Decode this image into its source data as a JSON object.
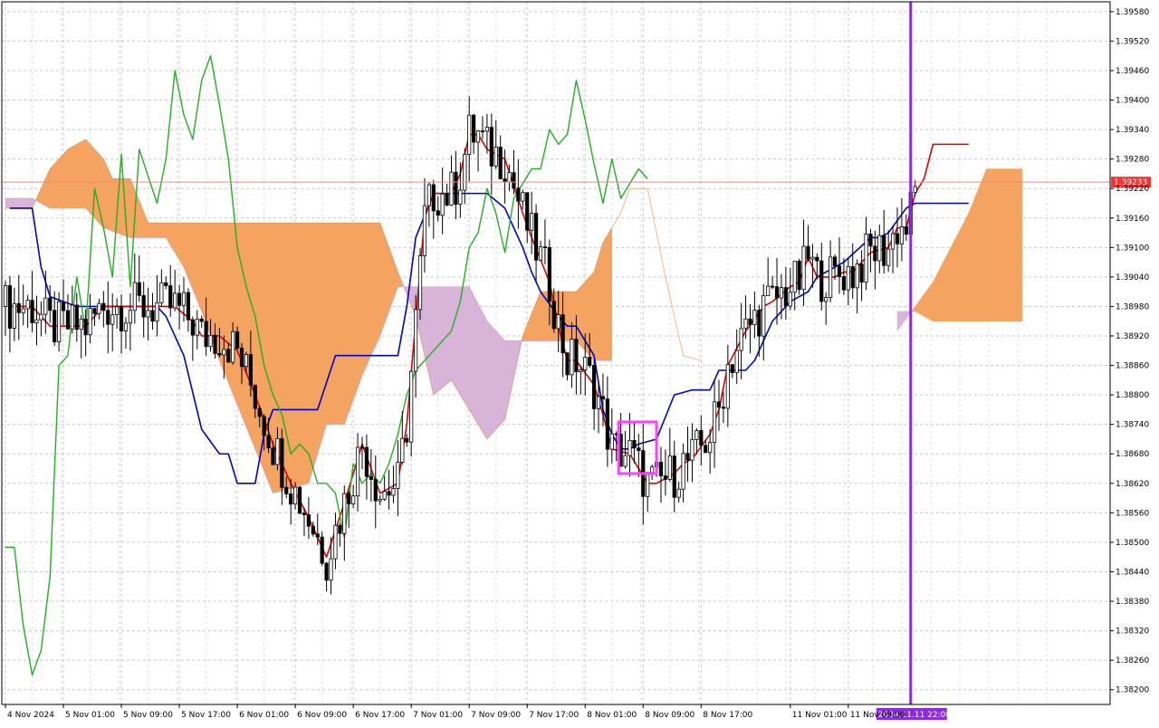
{
  "chart_data": {
    "type": "candlestick",
    "indicator": "Ichimoku Kinko Hyo",
    "current_price_label": "1.39233",
    "current_price": 1.39233,
    "cursor_time_label": "2024.11.11 22:00",
    "y_ticks": [
      "1.39580",
      "1.39520",
      "1.39460",
      "1.39400",
      "1.39340",
      "1.39280",
      "1.39220",
      "1.39160",
      "1.39100",
      "1.39040",
      "1.38980",
      "1.38920",
      "1.38860",
      "1.38800",
      "1.38740",
      "1.38680",
      "1.38620",
      "1.38560",
      "1.38500",
      "1.38440",
      "1.38380",
      "1.38320",
      "1.38260",
      "1.38200"
    ],
    "x_ticks": [
      "4 Nov 2024",
      "5 Nov 01:00",
      "5 Nov 09:00",
      "5 Nov 17:00",
      "6 Nov 01:00",
      "6 Nov 09:00",
      "6 Nov 17:00",
      "7 Nov 01:00",
      "7 Nov 09:00",
      "7 Nov 17:00",
      "8 Nov 01:00",
      "8 Nov 09:00",
      "8 Nov 17:00",
      "11 Nov 01:00",
      "11 Nov 09:00"
    ],
    "ylim": [
      1.3817,
      1.396
    ],
    "colors": {
      "grid": "#c8c8c8",
      "tenkan_sen": "#e00000",
      "kijun_sen": "#0000d0",
      "chikou_span": "#20b020",
      "senkou_bullish_cloud": "#f4a460",
      "senkou_bearish_cloud": "#d8b4d8",
      "price_line": "#ff8080",
      "price_label_bg": "#ff3030",
      "cursor_line": "#8a2be2",
      "highlight_box": "#ff40ff"
    },
    "tenkan_sen": [
      [
        1,
        1.3898
      ],
      [
        6,
        1.3898
      ],
      [
        10,
        1.3894
      ],
      [
        14,
        1.3894
      ],
      [
        18,
        1.3894
      ],
      [
        22,
        1.3898
      ],
      [
        26,
        1.3898
      ],
      [
        30,
        1.3898
      ],
      [
        34,
        1.3898
      ],
      [
        38,
        1.3898
      ],
      [
        42,
        1.3895
      ],
      [
        44,
        1.3892
      ],
      [
        48,
        1.3892
      ],
      [
        52,
        1.3889
      ],
      [
        56,
        1.388
      ],
      [
        60,
        1.387
      ],
      [
        64,
        1.3862
      ],
      [
        68,
        1.3855
      ],
      [
        72,
        1.3847
      ],
      [
        76,
        1.3858
      ],
      [
        80,
        1.387
      ],
      [
        84,
        1.386
      ],
      [
        88,
        1.3862
      ],
      [
        90,
        1.3874
      ],
      [
        94,
        1.3916
      ],
      [
        96,
        1.3921
      ],
      [
        100,
        1.3921
      ],
      [
        102,
        1.3925
      ],
      [
        104,
        1.3933
      ],
      [
        106,
        1.3933
      ],
      [
        108,
        1.393
      ],
      [
        112,
        1.3928
      ],
      [
        116,
        1.3917
      ],
      [
        118,
        1.3912
      ],
      [
        122,
        1.3903
      ],
      [
        124,
        1.3894
      ],
      [
        126,
        1.3887
      ],
      [
        128,
        1.3887
      ],
      [
        132,
        1.3882
      ],
      [
        134,
        1.3876
      ],
      [
        136,
        1.3869
      ],
      [
        140,
        1.3868
      ],
      [
        142,
        1.3865
      ],
      [
        144,
        1.3862
      ],
      [
        146,
        1.3862
      ],
      [
        148,
        1.3863
      ],
      [
        150,
        1.3864
      ],
      [
        152,
        1.3866
      ],
      [
        154,
        1.3867
      ],
      [
        158,
        1.3872
      ],
      [
        160,
        1.3877
      ],
      [
        162,
        1.3886
      ],
      [
        166,
        1.3893
      ],
      [
        170,
        1.3898
      ],
      [
        172,
        1.3899
      ],
      [
        176,
        1.3902
      ],
      [
        178,
        1.3903
      ],
      [
        180,
        1.3908
      ],
      [
        182,
        1.3904
      ],
      [
        184,
        1.3904
      ],
      [
        186,
        1.3904
      ],
      [
        188,
        1.3905
      ],
      [
        190,
        1.3905
      ],
      [
        194,
        1.3909
      ],
      [
        198,
        1.391
      ],
      [
        200,
        1.3914
      ],
      [
        202,
        1.3914
      ],
      [
        204,
        1.3921
      ],
      [
        206,
        1.3924
      ],
      [
        208,
        1.3931
      ],
      [
        212,
        1.3931
      ],
      [
        216,
        1.3931
      ]
    ],
    "kijun_sen": [
      [
        1,
        1.3918
      ],
      [
        6,
        1.3918
      ],
      [
        8,
        1.3906
      ],
      [
        10,
        1.39
      ],
      [
        16,
        1.3898
      ],
      [
        20,
        1.3898
      ],
      [
        26,
        1.3898
      ],
      [
        30,
        1.3898
      ],
      [
        34,
        1.3898
      ],
      [
        36,
        1.3896
      ],
      [
        40,
        1.3888
      ],
      [
        44,
        1.3873
      ],
      [
        48,
        1.3868
      ],
      [
        50,
        1.3868
      ],
      [
        52,
        1.3862
      ],
      [
        56,
        1.3862
      ],
      [
        58,
        1.3872
      ],
      [
        60,
        1.3877
      ],
      [
        62,
        1.3877
      ],
      [
        68,
        1.3877
      ],
      [
        70,
        1.3877
      ],
      [
        74,
        1.3888
      ],
      [
        80,
        1.3888
      ],
      [
        86,
        1.3888
      ],
      [
        88,
        1.3888
      ],
      [
        90,
        1.3898
      ],
      [
        92,
        1.3912
      ],
      [
        96,
        1.3921
      ],
      [
        100,
        1.3921
      ],
      [
        104,
        1.3921
      ],
      [
        108,
        1.3921
      ],
      [
        112,
        1.3918
      ],
      [
        116,
        1.391
      ],
      [
        118,
        1.3905
      ],
      [
        120,
        1.3901
      ],
      [
        124,
        1.3896
      ],
      [
        126,
        1.3894
      ],
      [
        128,
        1.3894
      ],
      [
        132,
        1.3888
      ],
      [
        134,
        1.3877
      ],
      [
        136,
        1.3872
      ],
      [
        138,
        1.3869
      ],
      [
        140,
        1.3869
      ],
      [
        142,
        1.387
      ],
      [
        146,
        1.3871
      ],
      [
        150,
        1.388
      ],
      [
        154,
        1.3881
      ],
      [
        158,
        1.3881
      ],
      [
        160,
        1.3885
      ],
      [
        166,
        1.3885
      ],
      [
        168,
        1.3887
      ],
      [
        172,
        1.3895
      ],
      [
        176,
        1.3899
      ],
      [
        180,
        1.3901
      ],
      [
        182,
        1.3904
      ],
      [
        186,
        1.3906
      ],
      [
        188,
        1.3907
      ],
      [
        194,
        1.3912
      ],
      [
        196,
        1.3912
      ],
      [
        198,
        1.3913
      ],
      [
        202,
        1.3918
      ],
      [
        204,
        1.3919
      ],
      [
        216,
        1.3919
      ]
    ],
    "chikou_span": [
      [
        0,
        1.3849
      ],
      [
        2,
        1.3849
      ],
      [
        4,
        1.3833
      ],
      [
        6,
        1.3823
      ],
      [
        8,
        1.3828
      ],
      [
        10,
        1.3843
      ],
      [
        12,
        1.3886
      ],
      [
        14,
        1.3888
      ],
      [
        16,
        1.3904
      ],
      [
        18,
        1.3893
      ],
      [
        20,
        1.3922
      ],
      [
        22,
        1.3914
      ],
      [
        24,
        1.3904
      ],
      [
        26,
        1.3929
      ],
      [
        28,
        1.3902
      ],
      [
        30,
        1.393
      ],
      [
        34,
        1.3919
      ],
      [
        36,
        1.3928
      ],
      [
        38,
        1.3946
      ],
      [
        40,
        1.3937
      ],
      [
        42,
        1.3932
      ],
      [
        44,
        1.3944
      ],
      [
        46,
        1.3949
      ],
      [
        48,
        1.3939
      ],
      [
        50,
        1.3928
      ],
      [
        52,
        1.391
      ],
      [
        54,
        1.3902
      ],
      [
        56,
        1.3896
      ],
      [
        58,
        1.3886
      ],
      [
        60,
        1.388
      ],
      [
        62,
        1.3876
      ],
      [
        64,
        1.3868
      ],
      [
        66,
        1.387
      ],
      [
        68,
        1.3868
      ],
      [
        70,
        1.3862
      ],
      [
        72,
        1.3862
      ],
      [
        74,
        1.386
      ],
      [
        76,
        1.3851
      ],
      [
        78,
        1.3866
      ],
      [
        80,
        1.3862
      ],
      [
        82,
        1.3864
      ],
      [
        84,
        1.3862
      ],
      [
        86,
        1.3866
      ],
      [
        88,
        1.3872
      ],
      [
        90,
        1.388
      ],
      [
        92,
        1.3885
      ],
      [
        96,
        1.3889
      ],
      [
        100,
        1.3893
      ],
      [
        102,
        1.3899
      ],
      [
        104,
        1.391
      ],
      [
        106,
        1.3913
      ],
      [
        108,
        1.3922
      ],
      [
        110,
        1.3917
      ],
      [
        112,
        1.3909
      ],
      [
        114,
        1.392
      ],
      [
        116,
        1.3923
      ],
      [
        118,
        1.3926
      ],
      [
        120,
        1.3926
      ],
      [
        122,
        1.3934
      ],
      [
        124,
        1.3931
      ],
      [
        126,
        1.3933
      ],
      [
        128,
        1.3944
      ],
      [
        130,
        1.3936
      ],
      [
        132,
        1.3927
      ],
      [
        134,
        1.3919
      ],
      [
        136,
        1.3928
      ],
      [
        138,
        1.392
      ],
      [
        140,
        1.3923
      ],
      [
        142,
        1.3926
      ],
      [
        144,
        1.3924
      ]
    ],
    "senkou_span_a": [
      [
        0,
        1.3918
      ],
      [
        6,
        1.3918
      ],
      [
        10,
        1.3926
      ],
      [
        14,
        1.393
      ],
      [
        18,
        1.3932
      ],
      [
        22,
        1.3928
      ],
      [
        24,
        1.3924
      ],
      [
        28,
        1.3924
      ],
      [
        32,
        1.3915
      ],
      [
        36,
        1.3915
      ],
      [
        40,
        1.3915
      ],
      [
        44,
        1.3915
      ],
      [
        48,
        1.3915
      ],
      [
        54,
        1.3915
      ],
      [
        58,
        1.3915
      ],
      [
        62,
        1.3915
      ],
      [
        66,
        1.3915
      ],
      [
        70,
        1.3915
      ],
      [
        76,
        1.3915
      ],
      [
        80,
        1.3915
      ],
      [
        84,
        1.3915
      ],
      [
        88,
        1.3905
      ],
      [
        92,
        1.3896
      ],
      [
        96,
        1.388
      ],
      [
        100,
        1.3883
      ],
      [
        104,
        1.3877
      ],
      [
        108,
        1.3871
      ],
      [
        112,
        1.3875
      ],
      [
        116,
        1.3892
      ],
      [
        120,
        1.3901
      ],
      [
        124,
        1.3901
      ],
      [
        128,
        1.3901
      ],
      [
        132,
        1.3905
      ],
      [
        134,
        1.3911
      ],
      [
        136,
        1.3914
      ],
      [
        138,
        1.3917
      ],
      [
        140,
        1.3922
      ],
      [
        144,
        1.3922
      ],
      [
        148,
        1.3904
      ],
      [
        152,
        1.3888
      ],
      [
        156,
        1.3887
      ]
    ],
    "senkou_span_b": [
      [
        0,
        1.392
      ],
      [
        6,
        1.392
      ],
      [
        10,
        1.3918
      ],
      [
        14,
        1.3918
      ],
      [
        18,
        1.3918
      ],
      [
        22,
        1.3914
      ],
      [
        28,
        1.3912
      ],
      [
        32,
        1.3912
      ],
      [
        36,
        1.3912
      ],
      [
        40,
        1.3906
      ],
      [
        44,
        1.3897
      ],
      [
        48,
        1.3887
      ],
      [
        52,
        1.3878
      ],
      [
        56,
        1.3869
      ],
      [
        60,
        1.386
      ],
      [
        64,
        1.3861
      ],
      [
        68,
        1.3862
      ],
      [
        72,
        1.3874
      ],
      [
        76,
        1.3874
      ],
      [
        80,
        1.3884
      ],
      [
        84,
        1.3892
      ],
      [
        88,
        1.3902
      ],
      [
        92,
        1.3902
      ],
      [
        96,
        1.3902
      ],
      [
        100,
        1.3902
      ],
      [
        104,
        1.3902
      ],
      [
        108,
        1.3895
      ],
      [
        112,
        1.3891
      ],
      [
        116,
        1.3891
      ],
      [
        120,
        1.3891
      ],
      [
        124,
        1.3891
      ],
      [
        128,
        1.3891
      ],
      [
        132,
        1.3887
      ],
      [
        136,
        1.3887
      ]
    ],
    "future_cloud_a": [
      [
        200,
        1.3893
      ],
      [
        204,
        1.3898
      ],
      [
        208,
        1.3903
      ],
      [
        212,
        1.391
      ],
      [
        216,
        1.3917
      ],
      [
        220,
        1.3926
      ],
      [
        224,
        1.3926
      ],
      [
        228,
        1.3926
      ]
    ],
    "future_cloud_b": [
      [
        200,
        1.3897
      ],
      [
        204,
        1.3897
      ],
      [
        208,
        1.3895
      ],
      [
        212,
        1.3895
      ],
      [
        216,
        1.3895
      ],
      [
        220,
        1.3895
      ],
      [
        224,
        1.3895
      ],
      [
        228,
        1.3895
      ]
    ],
    "candles": []
  }
}
